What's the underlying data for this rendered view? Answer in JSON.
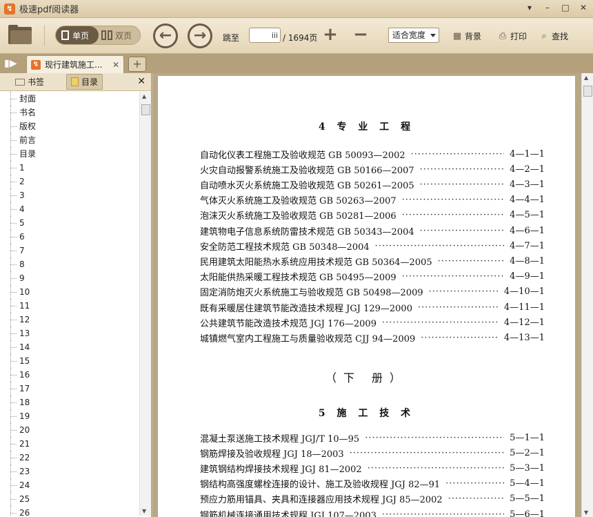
{
  "window": {
    "title": "极速pdf阅读器"
  },
  "toolbar": {
    "single_page": "单页",
    "double_page": "双页",
    "goto_label": "跳至",
    "page_input_value": "iii",
    "page_total": "/ 1694页",
    "fit_mode": "适合宽度",
    "background": "背景",
    "print": "打印",
    "find": "查找"
  },
  "tab": {
    "title": "现行建筑施工..."
  },
  "sidebar": {
    "bookmarks_tab": "书签",
    "toc_tab": "目录",
    "items": [
      "封面",
      "书名",
      "版权",
      "前言",
      "目录",
      "1",
      "2",
      "3",
      "4",
      "5",
      "6",
      "7",
      "8",
      "9",
      "10",
      "11",
      "12",
      "13",
      "14",
      "15",
      "16",
      "17",
      "18",
      "19",
      "20",
      "21",
      "22",
      "23",
      "24",
      "25",
      "26"
    ]
  },
  "document": {
    "section4_title": "4 专 业 工 程",
    "section4_entries": [
      {
        "title": "自动化仪表工程施工及验收规范 GB 50093—2002",
        "page": "4—1—1"
      },
      {
        "title": "火灾自动报警系统施工及验收规范 GB 50166—2007",
        "page": "4—2—1"
      },
      {
        "title": "自动喷水灭火系统施工及验收规范 GB 50261—2005",
        "page": "4—3—1"
      },
      {
        "title": "气体灭火系统施工及验收规范 GB 50263—2007",
        "page": "4—4—1"
      },
      {
        "title": "泡沫灭火系统施工及验收规范 GB 50281—2006",
        "page": "4—5—1"
      },
      {
        "title": "建筑物电子信息系统防雷技术规范 GB 50343—2004",
        "page": "4—6—1"
      },
      {
        "title": "安全防范工程技术规范 GB 50348—2004",
        "page": "4—7—1"
      },
      {
        "title": "民用建筑太阳能热水系统应用技术规范 GB 50364—2005",
        "page": "4—8—1"
      },
      {
        "title": "太阳能供热采暖工程技术规范 GB 50495—2009",
        "page": "4—9—1"
      },
      {
        "title": "固定消防炮灭火系统施工与验收规范 GB 50498—2009",
        "page": "4—10—1"
      },
      {
        "title": "既有采暖居住建筑节能改造技术规程 JGJ 129—2000",
        "page": "4—11—1"
      },
      {
        "title": "公共建筑节能改造技术规范 JGJ 176—2009",
        "page": "4—12—1"
      },
      {
        "title": "城镇燃气室内工程施工与质量验收规范 CJJ 94—2009",
        "page": "4—13—1"
      }
    ],
    "volume_title": "（下 册）",
    "section5_title": "5 施 工 技 术",
    "section5_entries": [
      {
        "title": "混凝土泵送施工技术规程 JGJ/T 10—95",
        "page": "5—1—1"
      },
      {
        "title": "钢筋焊接及验收规程 JGJ 18—2003",
        "page": "5—2—1"
      },
      {
        "title": "建筑钢结构焊接技术规程 JGJ 81—2002",
        "page": "5—3—1"
      },
      {
        "title": "钢结构高强度螺栓连接的设计、施工及验收规程 JGJ 82—91",
        "page": "5—4—1"
      },
      {
        "title": "预应力筋用锚具、夹具和连接器应用技术规程 JGJ 85—2002",
        "page": "5—5—1"
      },
      {
        "title": "钢筋机械连接通用技术规程 JGJ 107—2003",
        "page": "5—6—1"
      }
    ]
  },
  "colors": {
    "chrome": "#e4d5b6",
    "accent": "#6b5a44",
    "app_icon": "#e8722a"
  },
  "icons": [
    "folder-icon",
    "single-page-icon",
    "double-page-icon",
    "prev-arrow-icon",
    "next-arrow-icon",
    "zoom-in-icon",
    "zoom-out-icon",
    "background-icon",
    "print-icon",
    "search-icon",
    "sidebar-toggle-icon",
    "tab-close-icon",
    "new-tab-icon",
    "bookmark-icon",
    "toc-icon",
    "close-icon"
  ]
}
